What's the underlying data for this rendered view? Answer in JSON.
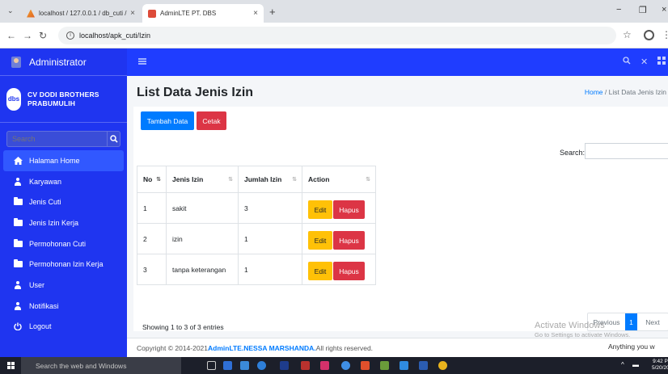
{
  "browser": {
    "tabs": [
      {
        "title": "localhost / 127.0.0.1 / db_cuti /",
        "close": "×"
      },
      {
        "title": "AdminLTE PT. DBS",
        "close": "×"
      }
    ],
    "new_tab": "+",
    "url": "localhost/apk_cuti/Izin",
    "window_controls": [
      "−",
      "❐",
      "×"
    ]
  },
  "sidebar": {
    "user": "Administrator",
    "logo_text": "dbs",
    "company_line1": "CV DODI BROTHERS",
    "company_line2": "PRABUMULIH",
    "search_placeholder": "Search",
    "items": [
      {
        "label": "Halaman Home",
        "icon": "home-icon"
      },
      {
        "label": "Karyawan",
        "icon": "user-icon"
      },
      {
        "label": "Jenis Cuti",
        "icon": "folder-icon"
      },
      {
        "label": "Jenis Izin Kerja",
        "icon": "folder-icon"
      },
      {
        "label": "Permohonan Cuti",
        "icon": "folder-icon"
      },
      {
        "label": "Permohonan Izin Kerja",
        "icon": "folder-icon"
      },
      {
        "label": "User",
        "icon": "user-icon"
      },
      {
        "label": "Notifikasi",
        "icon": "user-icon"
      },
      {
        "label": "Logout",
        "icon": "power-icon"
      }
    ]
  },
  "page": {
    "title": "List Data Jenis Izin",
    "breadcrumb_home": "Home",
    "breadcrumb_sep": "/",
    "breadcrumb_current": "List Data Jenis Izin",
    "btn_add": "Tambah Data",
    "btn_print": "Cetak",
    "search_label": "Search:"
  },
  "table": {
    "columns": [
      "No",
      "Jenis Izin",
      "Jumlah Izin",
      "Action"
    ],
    "rows": [
      {
        "no": "1",
        "jenis": "sakit",
        "jumlah": "3"
      },
      {
        "no": "2",
        "jenis": "izin",
        "jumlah": "1"
      },
      {
        "no": "3",
        "jenis": "tanpa keterangan",
        "jumlah": "1"
      }
    ],
    "edit_label": "Edit",
    "delete_label": "Hapus",
    "info": "Showing 1 to 3 of 3 entries",
    "pager": {
      "prev": "Previous",
      "page": "1",
      "next": "Next"
    }
  },
  "footer": {
    "prefix": "Copyright © 2014-2021 ",
    "link": "AdminLTE.NESSA MARSHANDA.",
    "suffix": " All rights reserved."
  },
  "watermark": {
    "line1": "Activate Windows",
    "line2": "Go to Settings to activate Windows.",
    "overlay": "Anything you w"
  },
  "taskbar": {
    "search": "Search the web and Windows",
    "time": "9:42 PM",
    "date": "5/20/202"
  }
}
